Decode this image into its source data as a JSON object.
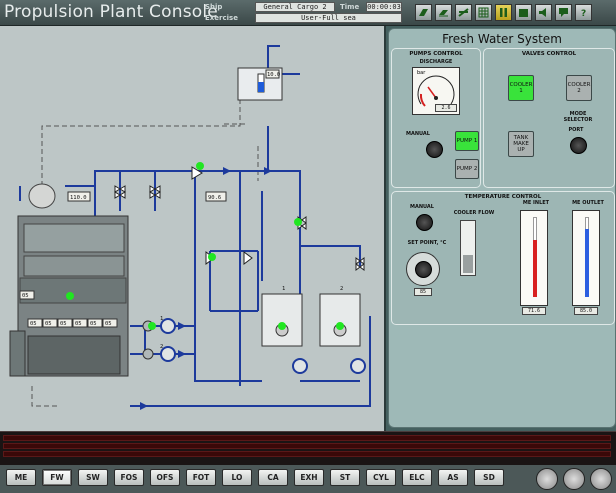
{
  "app_title": "Propulsion Plant Console",
  "header": {
    "ship_label": "Ship",
    "ship_value": "General Cargo 2",
    "time_label": "Time",
    "time_value": "00:00:03",
    "exercise_label": "Exercise",
    "exercise_value": "User-Full sea"
  },
  "toolbar": {
    "icons": [
      "book-icon",
      "book-open-icon",
      "grid-icon",
      "pause-icon",
      "calendar-icon",
      "speaker-icon",
      "chat-icon",
      "help-icon"
    ]
  },
  "diagram": {
    "labels": {
      "expansion_tank_level": "10.0",
      "outlet_temp": "110.0",
      "valve_reading": "90.6",
      "engine_gauge": "05",
      "cylinder_gauges": [
        "05",
        "05",
        "05",
        "05",
        "05",
        "05"
      ],
      "pump_labels": [
        "1",
        "2"
      ],
      "cooler_labels": [
        "1",
        "2"
      ]
    },
    "colors": {
      "pipe": "#1d3a9c",
      "status_on": "#21e621",
      "background": "#bdc6c6"
    }
  },
  "fws": {
    "title": "Fresh Water System",
    "pumps_control": {
      "title": "PUMPS CONTROL",
      "discharge_label": "DISCHARGE",
      "gauge_unit": "bar",
      "gauge_scale": [
        "0",
        "1",
        "2",
        "3",
        "4",
        "5",
        "6"
      ],
      "gauge_value": 2.6,
      "gauge_readout": "2.6",
      "mode_labels": [
        "MANUAL",
        "A",
        "U",
        "T",
        "O"
      ],
      "pump1_label": "PUMP 1",
      "pump2_label": "PUMP 2"
    },
    "valves_control": {
      "title": "VALVES CONTROL",
      "cooler1_label": "COOLER 1",
      "cooler2_label": "COOLER 2",
      "tank_makeup_label": "TANK MAKE UP",
      "mode_selector_label": "MODE SELECTOR",
      "port_label": "PORT",
      "stbd_label": "STBD"
    },
    "temperature_control": {
      "title": "TEMPERATURE CONTROL",
      "manual_label": "MANUAL",
      "auto_label": "AUTO",
      "setpoint_label": "SET POINT, °C",
      "setpoint_scale": [
        "60",
        "70",
        "80",
        "90"
      ],
      "setpoint_readout": "85",
      "cooler_flow_label": "COOLER FLOW",
      "cooler_flow_scale": [
        "100",
        "90",
        "80",
        "70",
        "60",
        "50",
        "40",
        "30",
        "20",
        "10",
        "0"
      ],
      "me_inlet_label": "ME INLET",
      "me_outlet_label": "ME OUTLET",
      "thermo_scale": [
        "100",
        "90",
        "80",
        "70",
        "60",
        "50",
        "40",
        "30",
        "20",
        "10",
        "0"
      ],
      "thermo_unit": "°C",
      "me_inlet_readout": "71.6",
      "me_outlet_readout": "85.0"
    }
  },
  "nav_buttons": [
    "ME",
    "FW",
    "SW",
    "FOS",
    "OFS",
    "FOT",
    "LO",
    "CA",
    "EXH",
    "ST",
    "CYL",
    "ELC",
    "AS",
    "SD"
  ],
  "nav_active": "FW",
  "nav_icons": [
    "fan-icon",
    "lightning-icon",
    "gear-icon"
  ]
}
